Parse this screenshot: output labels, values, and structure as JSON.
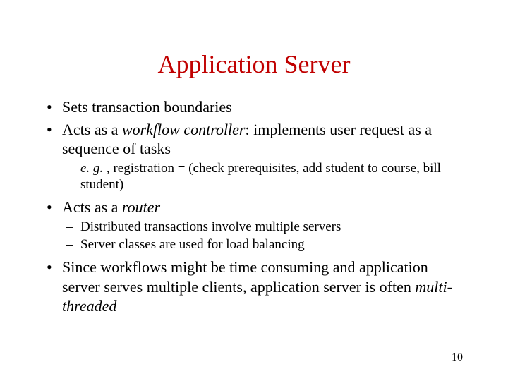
{
  "title": "Application Server",
  "bullets": {
    "b1": {
      "text": "Sets transaction boundaries"
    },
    "b2": {
      "p1": "Acts as a ",
      "p2_italic": "workflow controller",
      "p3": ": implements user request as a sequence of tasks",
      "sub1_italic": "e. g. , ",
      "sub1_rest": "registration = (check prerequisites, add student to course, bill student)"
    },
    "b3": {
      "p1": "Acts as a ",
      "p2_italic": "router",
      "sub1": "Distributed transactions involve multiple servers",
      "sub2": "Server classes are used for load balancing"
    },
    "b4": {
      "p1": "Since workflows might be time consuming and application server serves multiple clients, application server is often ",
      "p2_italic": "multi-threaded"
    }
  },
  "page_number": "10"
}
